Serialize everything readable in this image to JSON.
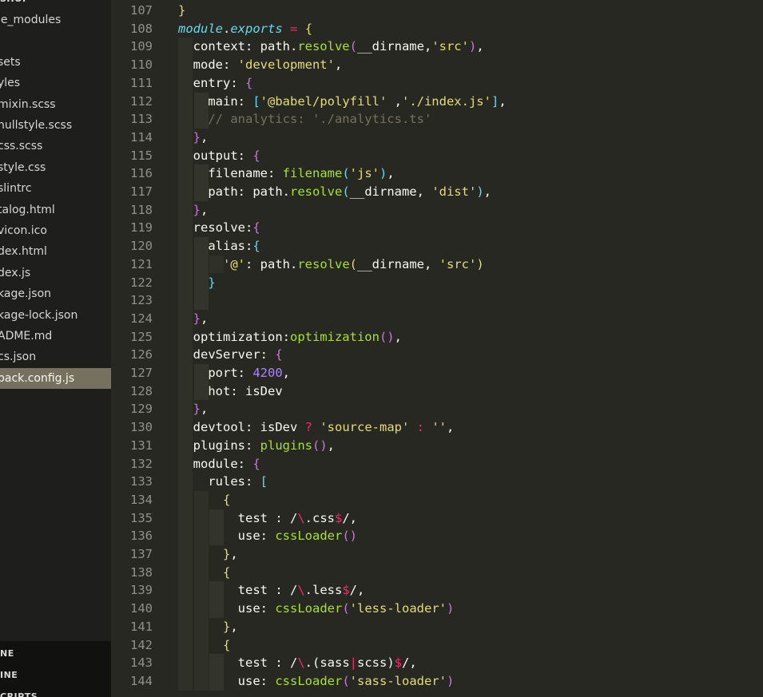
{
  "sidebar": {
    "project_header": "SHOP",
    "files": [
      {
        "label": "le_modules"
      },
      {
        "label": ""
      },
      {
        "label": "sets"
      },
      {
        "label": "yles"
      },
      {
        "label": "mixin.scss"
      },
      {
        "label": "nullstyle.scss"
      },
      {
        "label": "css.scss"
      },
      {
        "label": "style.css"
      },
      {
        "label": "slintrc"
      },
      {
        "label": "talog.html"
      },
      {
        "label": "vicon.ico"
      },
      {
        "label": "dex.html"
      },
      {
        "label": "dex.js"
      },
      {
        "label": "kage.json"
      },
      {
        "label": "kage-lock.json"
      },
      {
        "label": "ADME.md"
      },
      {
        "label": "cs.json"
      },
      {
        "label": "pack.config.js"
      }
    ],
    "active_file_index": 17,
    "sections": [
      {
        "label": "NE"
      },
      {
        "label": "INE"
      },
      {
        "label": "CRIPTS"
      }
    ]
  },
  "editor": {
    "line_numbers": [
      "107",
      "108",
      "109",
      "110",
      "111",
      "112",
      "113",
      "114",
      "115",
      "116",
      "117",
      "118",
      "119",
      "120",
      "121",
      "122",
      "123",
      "124",
      "125",
      "126",
      "127",
      "128",
      "129",
      "130",
      "131",
      "132",
      "133",
      "134",
      "135",
      "136",
      "137",
      "138",
      "139",
      "140",
      "141",
      "142",
      "143",
      "144"
    ],
    "lines": [
      [
        {
          "t": "}",
          "c": "by"
        }
      ],
      [
        {
          "t": "module",
          "c": "m"
        },
        {
          "t": ".",
          "c": "w"
        },
        {
          "t": "exports",
          "c": "m"
        },
        {
          "t": " ",
          "c": "w"
        },
        {
          "t": "=",
          "c": "k"
        },
        {
          "t": " ",
          "c": "w"
        },
        {
          "t": "{",
          "c": "by"
        }
      ],
      [
        {
          "t": "  context: path.",
          "c": "w"
        },
        {
          "t": "resolve",
          "c": "f"
        },
        {
          "t": "(",
          "c": "bp"
        },
        {
          "t": "__dirname,",
          "c": "w"
        },
        {
          "t": "'src'",
          "c": "s"
        },
        {
          "t": ")",
          "c": "bp"
        },
        {
          "t": ",",
          "c": "w"
        }
      ],
      [
        {
          "t": "  mode: ",
          "c": "w"
        },
        {
          "t": "'development'",
          "c": "s"
        },
        {
          "t": ",",
          "c": "w"
        }
      ],
      [
        {
          "t": "  entry: ",
          "c": "w"
        },
        {
          "t": "{",
          "c": "bp"
        }
      ],
      [
        {
          "t": "    main: ",
          "c": "w"
        },
        {
          "t": "[",
          "c": "bb"
        },
        {
          "t": "'@babel/polyfill'",
          "c": "s"
        },
        {
          "t": " ,",
          "c": "w"
        },
        {
          "t": "'./index.js'",
          "c": "s"
        },
        {
          "t": "]",
          "c": "bb"
        },
        {
          "t": ",",
          "c": "w"
        }
      ],
      [
        {
          "t": "    // analytics: './analytics.ts'",
          "c": "c"
        }
      ],
      [
        {
          "t": "  ",
          "c": "w"
        },
        {
          "t": "}",
          "c": "bp"
        },
        {
          "t": ",",
          "c": "w"
        }
      ],
      [
        {
          "t": "  output: ",
          "c": "w"
        },
        {
          "t": "{",
          "c": "bp"
        }
      ],
      [
        {
          "t": "    filename: ",
          "c": "w"
        },
        {
          "t": "filename",
          "c": "f"
        },
        {
          "t": "(",
          "c": "bb"
        },
        {
          "t": "'js'",
          "c": "s"
        },
        {
          "t": ")",
          "c": "bb"
        },
        {
          "t": ",",
          "c": "w"
        }
      ],
      [
        {
          "t": "    path: path.",
          "c": "w"
        },
        {
          "t": "resolve",
          "c": "f"
        },
        {
          "t": "(",
          "c": "bb"
        },
        {
          "t": "__dirname, ",
          "c": "w"
        },
        {
          "t": "'dist'",
          "c": "s"
        },
        {
          "t": ")",
          "c": "bb"
        },
        {
          "t": ",",
          "c": "w"
        }
      ],
      [
        {
          "t": "  ",
          "c": "w"
        },
        {
          "t": "}",
          "c": "bp"
        },
        {
          "t": ",",
          "c": "w"
        }
      ],
      [
        {
          "t": "  resolve:",
          "c": "w"
        },
        {
          "t": "{",
          "c": "bp"
        }
      ],
      [
        {
          "t": "    alias:",
          "c": "w"
        },
        {
          "t": "{",
          "c": "bb"
        }
      ],
      [
        {
          "t": "      ",
          "c": "w"
        },
        {
          "t": "'@'",
          "c": "s"
        },
        {
          "t": ": path.",
          "c": "w"
        },
        {
          "t": "resolve",
          "c": "f"
        },
        {
          "t": "(",
          "c": "by"
        },
        {
          "t": "__dirname, ",
          "c": "w"
        },
        {
          "t": "'src'",
          "c": "s"
        },
        {
          "t": ")",
          "c": "by"
        }
      ],
      [
        {
          "t": "    ",
          "c": "w"
        },
        {
          "t": "}",
          "c": "bb"
        }
      ],
      [
        {
          "t": "",
          "c": "w"
        }
      ],
      [
        {
          "t": "  ",
          "c": "w"
        },
        {
          "t": "}",
          "c": "bp"
        },
        {
          "t": ",",
          "c": "w"
        }
      ],
      [
        {
          "t": "  optimization:",
          "c": "w"
        },
        {
          "t": "optimization",
          "c": "f"
        },
        {
          "t": "()",
          "c": "bp"
        },
        {
          "t": ",",
          "c": "w"
        }
      ],
      [
        {
          "t": "  devServer: ",
          "c": "w"
        },
        {
          "t": "{",
          "c": "bp"
        }
      ],
      [
        {
          "t": "    port: ",
          "c": "w"
        },
        {
          "t": "4200",
          "c": "n"
        },
        {
          "t": ",",
          "c": "w"
        }
      ],
      [
        {
          "t": "    hot: isDev",
          "c": "w"
        }
      ],
      [
        {
          "t": "  ",
          "c": "w"
        },
        {
          "t": "}",
          "c": "bp"
        },
        {
          "t": ",",
          "c": "w"
        }
      ],
      [
        {
          "t": "  devtool: isDev ",
          "c": "w"
        },
        {
          "t": "?",
          "c": "k"
        },
        {
          "t": " ",
          "c": "w"
        },
        {
          "t": "'source-map'",
          "c": "s"
        },
        {
          "t": " ",
          "c": "w"
        },
        {
          "t": ":",
          "c": "k"
        },
        {
          "t": " ",
          "c": "w"
        },
        {
          "t": "''",
          "c": "s"
        },
        {
          "t": ",",
          "c": "w"
        }
      ],
      [
        {
          "t": "  plugins: ",
          "c": "w"
        },
        {
          "t": "plugins",
          "c": "f"
        },
        {
          "t": "()",
          "c": "bp"
        },
        {
          "t": ",",
          "c": "w"
        }
      ],
      [
        {
          "t": "  module: ",
          "c": "w"
        },
        {
          "t": "{",
          "c": "bp"
        }
      ],
      [
        {
          "t": "    rules: ",
          "c": "w"
        },
        {
          "t": "[",
          "c": "bb"
        }
      ],
      [
        {
          "t": "      ",
          "c": "w"
        },
        {
          "t": "{",
          "c": "by"
        }
      ],
      [
        {
          "t": "        test : /",
          "c": "w"
        },
        {
          "t": "\\",
          "c": "k"
        },
        {
          "t": ".css",
          "c": "w"
        },
        {
          "t": "$",
          "c": "k"
        },
        {
          "t": "/,",
          "c": "w"
        }
      ],
      [
        {
          "t": "        use: ",
          "c": "w"
        },
        {
          "t": "cssLoader",
          "c": "f"
        },
        {
          "t": "()",
          "c": "bp"
        }
      ],
      [
        {
          "t": "      ",
          "c": "w"
        },
        {
          "t": "}",
          "c": "by"
        },
        {
          "t": ",",
          "c": "w"
        }
      ],
      [
        {
          "t": "      ",
          "c": "w"
        },
        {
          "t": "{",
          "c": "by"
        }
      ],
      [
        {
          "t": "        test : /",
          "c": "w"
        },
        {
          "t": "\\",
          "c": "k"
        },
        {
          "t": ".less",
          "c": "w"
        },
        {
          "t": "$",
          "c": "k"
        },
        {
          "t": "/,",
          "c": "w"
        }
      ],
      [
        {
          "t": "        use: ",
          "c": "w"
        },
        {
          "t": "cssLoader",
          "c": "f"
        },
        {
          "t": "(",
          "c": "bp"
        },
        {
          "t": "'less-loader'",
          "c": "s"
        },
        {
          "t": ")",
          "c": "bp"
        }
      ],
      [
        {
          "t": "      ",
          "c": "w"
        },
        {
          "t": "}",
          "c": "by"
        },
        {
          "t": ",",
          "c": "w"
        }
      ],
      [
        {
          "t": "      ",
          "c": "w"
        },
        {
          "t": "{",
          "c": "by"
        }
      ],
      [
        {
          "t": "        test : /",
          "c": "w"
        },
        {
          "t": "\\",
          "c": "k"
        },
        {
          "t": ".(sass",
          "c": "w"
        },
        {
          "t": "|",
          "c": "k"
        },
        {
          "t": "scss)",
          "c": "w"
        },
        {
          "t": "$",
          "c": "k"
        },
        {
          "t": "/,",
          "c": "w"
        }
      ],
      [
        {
          "t": "        use: ",
          "c": "w"
        },
        {
          "t": "cssLoader",
          "c": "f"
        },
        {
          "t": "(",
          "c": "bp"
        },
        {
          "t": "'sass-loader'",
          "c": "s"
        },
        {
          "t": ")",
          "c": "bp"
        }
      ]
    ]
  },
  "colors": {
    "background": "#272822",
    "sidebar": "#1e1f1c",
    "active_file": "#75715e",
    "string": "#e6db74",
    "function": "#a6e22e",
    "keyword": "#f92672",
    "number": "#ae81ff",
    "comment": "#75715e"
  }
}
